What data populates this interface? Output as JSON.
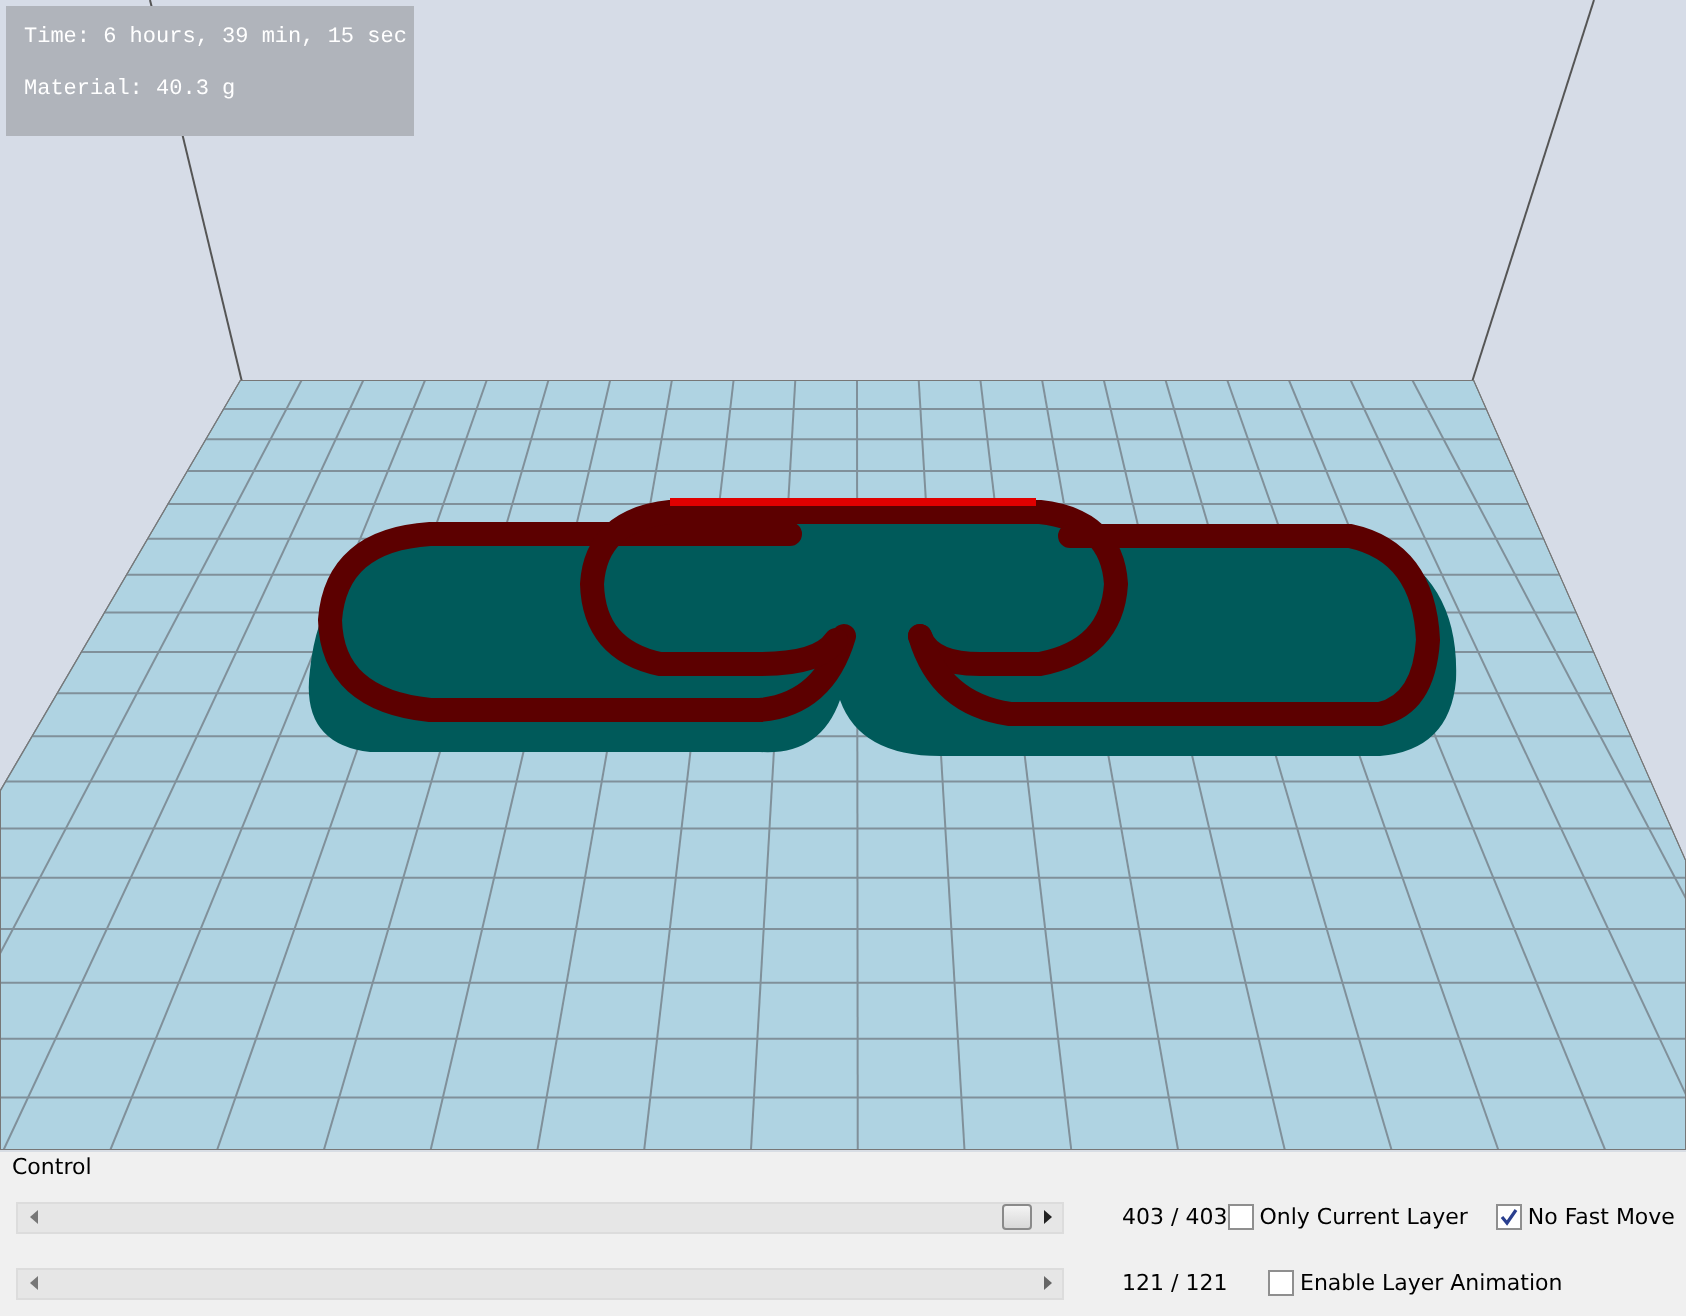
{
  "viewport": {
    "stats": [
      "Time: 6 hours, 39 min, 15 sec",
      "Material: 40.3 g"
    ]
  },
  "control": {
    "title": "Control",
    "rows": [
      {
        "level": 1,
        "reading": "403 / 403",
        "checkboxes": [
          {
            "label": "Only Current Layer",
            "checked": false
          },
          {
            "label": "No Fast Move",
            "checked": true
          }
        ]
      },
      {
        "reading": "121 / 121",
        "checkboxes": [
          {
            "label": "Enable Layer Animation",
            "checked": false
          }
        ]
      }
    ]
  }
}
